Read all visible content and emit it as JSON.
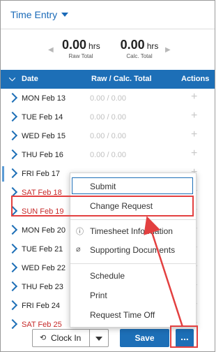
{
  "header": {
    "title": "Time Entry"
  },
  "totals": {
    "raw": {
      "value": "0.00",
      "unit": "hrs",
      "label": "Raw Total"
    },
    "calc": {
      "value": "0.00",
      "unit": "hrs",
      "label": "Calc. Total"
    }
  },
  "table": {
    "columns": [
      "Date",
      "Raw / Calc. Total",
      "Actions"
    ],
    "rows": [
      {
        "date": "MON Feb 13",
        "total": "0.00 / 0.00",
        "weekend": false
      },
      {
        "date": "TUE Feb 14",
        "total": "0.00 / 0.00",
        "weekend": false
      },
      {
        "date": "WED Feb 15",
        "total": "0.00 / 0.00",
        "weekend": false
      },
      {
        "date": "THU Feb 16",
        "total": "0.00 / 0.00",
        "weekend": false
      },
      {
        "date": "FRI Feb 17",
        "total": "",
        "weekend": false
      },
      {
        "date": "SAT Feb 18",
        "total": "",
        "weekend": true
      },
      {
        "date": "SUN Feb 19",
        "total": "",
        "weekend": true
      },
      {
        "date": "MON Feb 20",
        "total": "",
        "weekend": false
      },
      {
        "date": "TUE Feb 21",
        "total": "",
        "weekend": false
      },
      {
        "date": "WED Feb 22",
        "total": "",
        "weekend": false
      },
      {
        "date": "THU Feb 23",
        "total": "",
        "weekend": false
      },
      {
        "date": "FRI Feb 24",
        "total": "",
        "weekend": false
      },
      {
        "date": "SAT Feb 25",
        "total": "",
        "weekend": true
      }
    ]
  },
  "menu": {
    "items": [
      "Submit",
      "Change Request",
      "Timesheet Information",
      "Supporting Documents",
      "Schedule",
      "Print",
      "Request Time Off"
    ]
  },
  "footer": {
    "clock_in": "Clock In",
    "save": "Save",
    "more": "..."
  },
  "colors": {
    "accent": "#1d6fb7",
    "weekend": "#c62828",
    "highlight": "#e34040"
  }
}
